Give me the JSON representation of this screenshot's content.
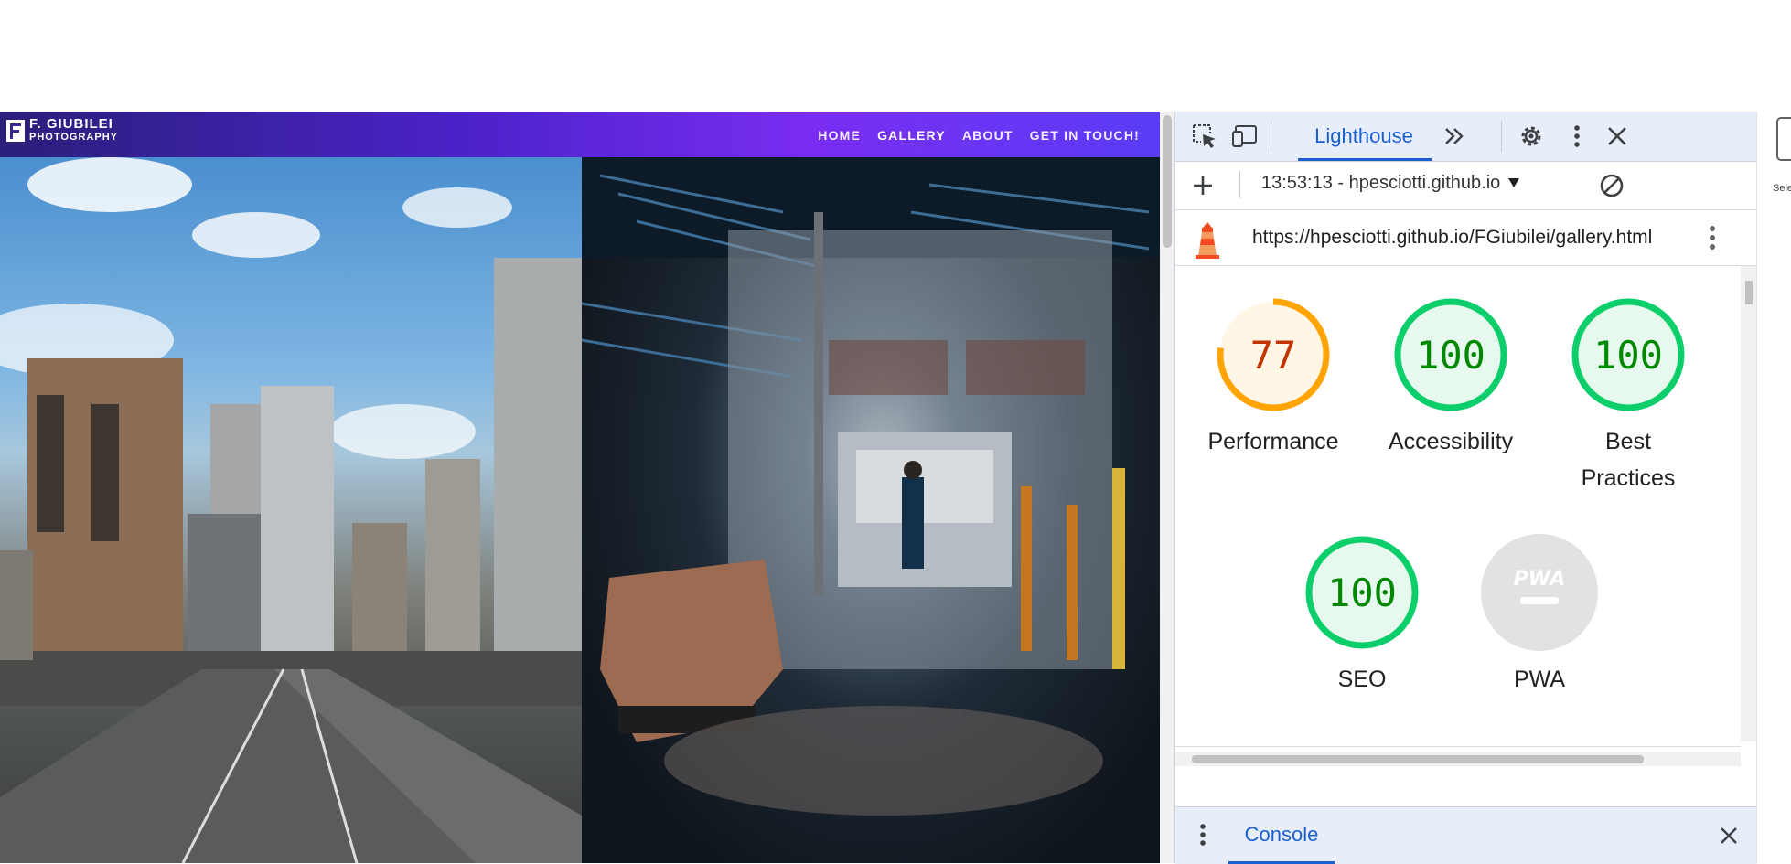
{
  "site": {
    "logo_line1": "F. GIUBILEI",
    "logo_line2": "PHOTOGRAPHY",
    "nav": [
      "HOME",
      "GALLERY",
      "ABOUT",
      "GET IN TOUCH!"
    ],
    "active_nav": "GALLERY",
    "colors": {
      "nav_gradient_start": "#2a1f7a",
      "nav_gradient_end": "#7a2df2"
    }
  },
  "devtools": {
    "active_tab": "Lighthouse",
    "report_selector": "13:53:13 - hpesciotti.github.io",
    "url": "https://hpesciotti.github.io/FGiubilei/gallery.html",
    "drawer_tab": "Console",
    "edge_partial_label": "Sele",
    "scores": [
      {
        "label": "Performance",
        "value": "77",
        "score": 77,
        "status": "average"
      },
      {
        "label": "Accessibility",
        "value": "100",
        "score": 100,
        "status": "pass"
      },
      {
        "label": "Best Practices",
        "value": "100",
        "score": 100,
        "status": "pass"
      },
      {
        "label": "SEO",
        "value": "100",
        "score": 100,
        "status": "pass"
      },
      {
        "label": "PWA",
        "value": "PWA",
        "score": null,
        "status": "na"
      }
    ],
    "colors": {
      "pass": "#0cce6b",
      "pass_text": "#008800",
      "pass_bg": "#e7f8ee",
      "average": "#ffa400",
      "average_text": "#c33300",
      "average_bg": "#fff6e6",
      "na_bg": "#e2e2e2",
      "accent": "#1a5fd1"
    },
    "icons": [
      "inspect-element-icon",
      "device-toolbar-icon",
      "more-tabs-icon",
      "settings-icon",
      "kebab-menu-icon",
      "close-icon",
      "add-icon",
      "dropdown-caret-icon",
      "clear-icon",
      "lighthouse-icon"
    ]
  }
}
